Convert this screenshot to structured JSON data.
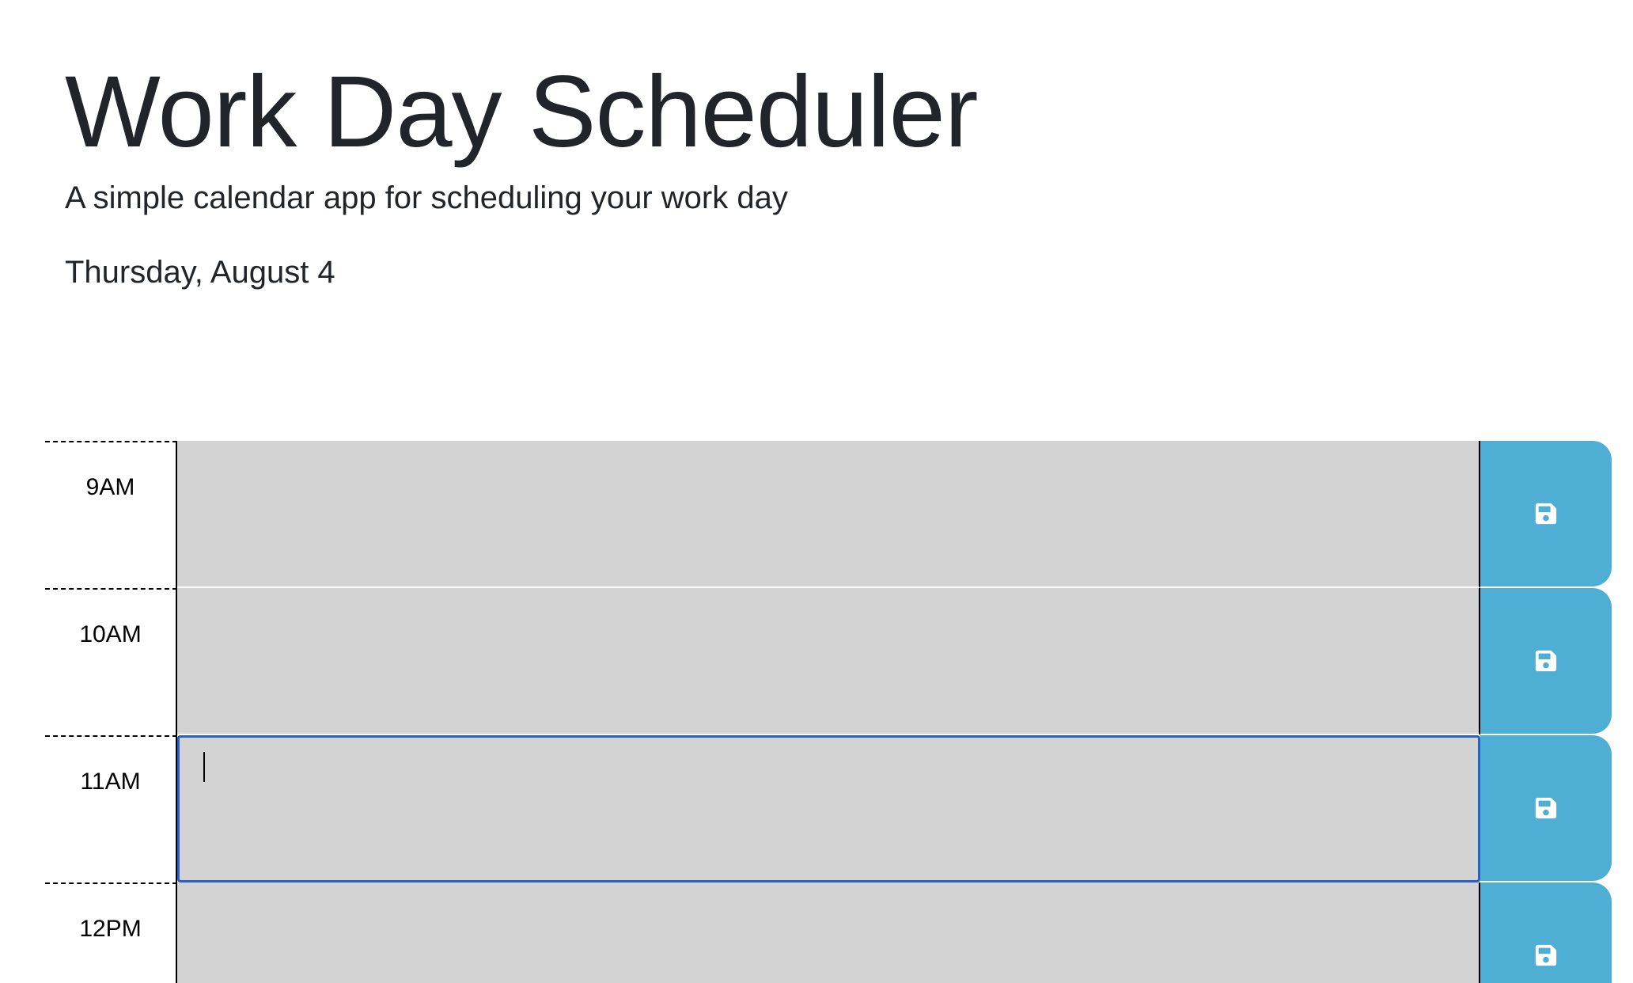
{
  "header": {
    "title": "Work Day Scheduler",
    "subtitle": "A simple calendar app for scheduling your work day",
    "current_date": "Thursday, August 4"
  },
  "schedule": {
    "rows": [
      {
        "hour": "9AM",
        "text": "",
        "status": "past"
      },
      {
        "hour": "10AM",
        "text": "",
        "status": "past"
      },
      {
        "hour": "11AM",
        "text": "",
        "status": "past",
        "focused": true
      },
      {
        "hour": "12PM",
        "text": "",
        "status": "past"
      }
    ],
    "save_icon": "floppy-disk-icon"
  },
  "colors": {
    "past_row": "#d3d3d3",
    "save_button": "#4faed4",
    "focus_ring": "#2a5ec8"
  }
}
